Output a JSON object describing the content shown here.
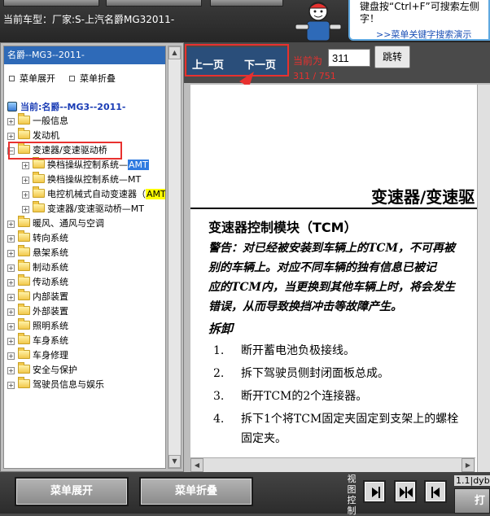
{
  "top": {
    "car_model": "当前车型：厂家:S-上汽名爵MG32011-",
    "hint_text": "键盘按“Ctrl+F”可搜索左侧字！",
    "hint_link": ">>菜单关键字搜索演示"
  },
  "tree": {
    "header": "名爵--MG3--2011-",
    "expand_label": "菜单展开",
    "collapse_label": "菜单折叠",
    "current": "当前:名爵--MG3--2011-",
    "items": [
      {
        "label": "一般信息"
      },
      {
        "label": "发动机"
      },
      {
        "label": "变速器/变速驱动桥"
      },
      {
        "label": "换档操纵控制系统—",
        "tag": "AMT"
      },
      {
        "label": "换档操纵控制系统—MT"
      },
      {
        "label": "电控机械式自动变速器（",
        "tag": "AMT"
      },
      {
        "label": "变速器/变速驱动桥—MT"
      },
      {
        "label": "暖风、通风与空调"
      },
      {
        "label": "转向系统"
      },
      {
        "label": "悬架系统"
      },
      {
        "label": "制动系统"
      },
      {
        "label": "传动系统"
      },
      {
        "label": "内部装置"
      },
      {
        "label": "外部装置"
      },
      {
        "label": "照明系统"
      },
      {
        "label": "车身系统"
      },
      {
        "label": "车身修理"
      },
      {
        "label": "安全与保护"
      },
      {
        "label": "驾驶员信息与娱乐"
      }
    ]
  },
  "nav": {
    "prev": "上一页",
    "next": "下一页",
    "current_label": "当前为",
    "page_value": "311",
    "jump": "跳转",
    "page_count": "311 / 751"
  },
  "doc": {
    "title": "变速器/变速驱",
    "section_title": "变速器控制模块（TCM）",
    "warning_lines": [
      "警告：对已经被安装到车辆上的TCM，不可再被",
      "别的车辆上。对应不同车辆的独有信息已被记",
      "应的TCM内，当更换到其他车辆上时，将会发生",
      "错误，从而导致换挡冲击等故障产生。"
    ],
    "remove_heading": "拆卸",
    "steps": [
      {
        "num": "1.",
        "text": "断开蓄电池负极接线。"
      },
      {
        "num": "2.",
        "text": "拆下驾驶员侧封闭面板总成。"
      },
      {
        "num": "3.",
        "text": "断开TCM的2个连接器。"
      },
      {
        "num": "4.",
        "text": "拆下1个将TCM固定夹固定到支架上的螺栓"
      },
      {
        "num": "",
        "text": "固定夹。"
      }
    ]
  },
  "bottom": {
    "expand_btn": "菜单展开",
    "collapse_btn": "菜单折叠",
    "view_label": "视图控制",
    "version": "1.1|dyb",
    "corner_btn": "打"
  },
  "colors": {
    "tree_header": "#2e6ab8",
    "highlight_box": "#e8312f",
    "page_text": "#e8312f"
  }
}
